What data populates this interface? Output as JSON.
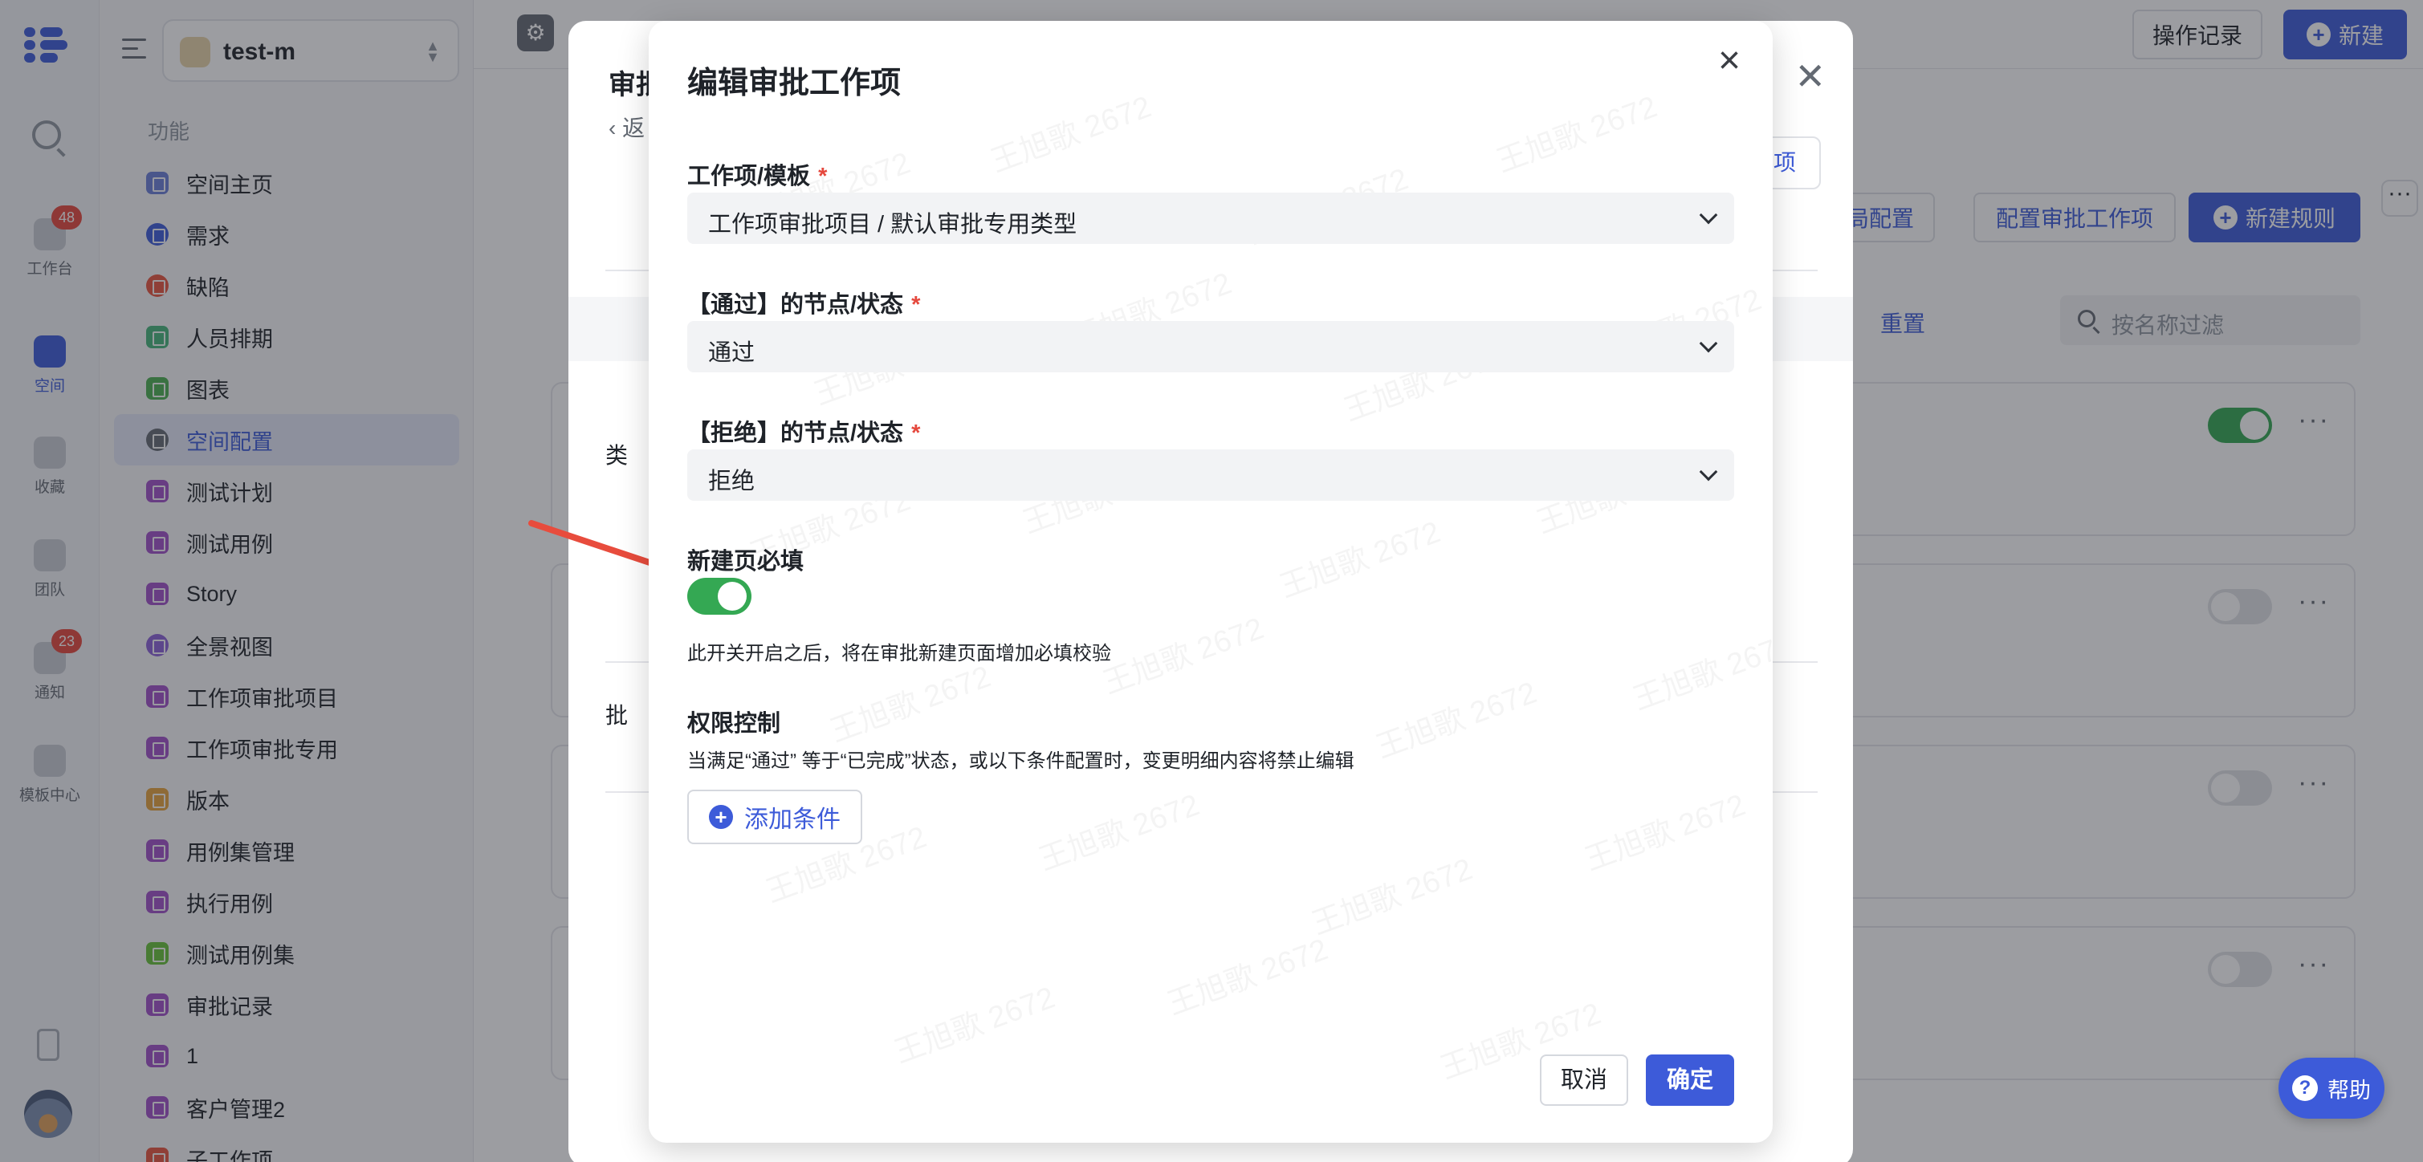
{
  "rail": {
    "items": [
      {
        "label": "工作台",
        "badge": "48"
      },
      {
        "label": "空间",
        "badge": ""
      },
      {
        "label": "收藏",
        "badge": ""
      },
      {
        "label": "团队",
        "badge": ""
      },
      {
        "label": "通知",
        "badge": "23"
      },
      {
        "label": "模板中心",
        "badge": ""
      }
    ]
  },
  "sidebar": {
    "space_name": "test-m",
    "section_title": "功能",
    "items": [
      {
        "label": "空间主页",
        "color": "#6b7fd7"
      },
      {
        "label": "需求",
        "color": "#3d5bd9"
      },
      {
        "label": "缺陷",
        "color": "#e8553e"
      },
      {
        "label": "人员排期",
        "color": "#46b47a"
      },
      {
        "label": "图表",
        "color": "#4caf50"
      },
      {
        "label": "空间配置",
        "color": "#646a73"
      },
      {
        "label": "测试计划",
        "color": "#a050c8"
      },
      {
        "label": "测试用例",
        "color": "#a050c8"
      },
      {
        "label": "Story",
        "color": "#a050c8"
      },
      {
        "label": "全景视图",
        "color": "#8a62d8"
      },
      {
        "label": "工作项审批项目",
        "color": "#a050c8"
      },
      {
        "label": "工作项审批专用",
        "color": "#a050c8"
      },
      {
        "label": "版本",
        "color": "#e6a23c"
      },
      {
        "label": "用例集管理",
        "color": "#a050c8"
      },
      {
        "label": "执行用例",
        "color": "#a050c8"
      },
      {
        "label": "测试用例集",
        "color": "#67c23a"
      },
      {
        "label": "审批记录",
        "color": "#a050c8"
      },
      {
        "label": "1",
        "color": "#a050c8"
      },
      {
        "label": "客户管理2",
        "color": "#a050c8"
      },
      {
        "label": "子工作项",
        "color": "#e8553e"
      }
    ]
  },
  "topbar": {
    "op_log": "操作记录",
    "new": "新建"
  },
  "main": {
    "global_config": "全局配置",
    "config_approval": "配置审批工作项",
    "new_rule": "新建规则",
    "reset": "重置",
    "filter_placeholder": "按名称过滤",
    "link_btn": "项"
  },
  "back_drawer": {
    "title": "审批",
    "back": "返",
    "label_type": "类",
    "label_approval": "批"
  },
  "modal": {
    "title": "编辑审批工作项",
    "field1_label": "工作项/模板",
    "field1_value": "工作项审批项目 / 默认审批专用类型",
    "field2_label": "【通过】的节点/状态",
    "field2_value": "通过",
    "field3_label": "【拒绝】的节点/状态",
    "field3_value": "拒绝",
    "required_mark": "*",
    "toggle_label": "新建页必填",
    "toggle_on": true,
    "toggle_hint": "此开关开启之后，将在审批新建页面增加必填校验",
    "perm_title": "权限控制",
    "perm_hint": "当满足“通过” 等于“已完成”状态，或以下条件配置时，变更明细内容将禁止编辑",
    "add_condition": "添加条件",
    "cancel": "取消",
    "confirm": "确定",
    "watermark": "王旭歌 2672"
  },
  "help": {
    "label": "帮助"
  }
}
